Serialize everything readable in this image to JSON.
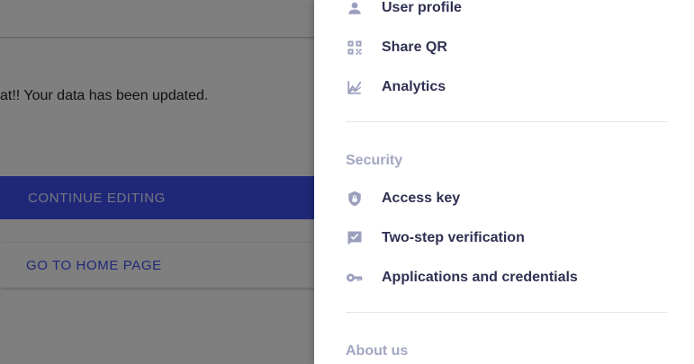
{
  "background": {
    "message": "at!! Your data has been updated.",
    "primary_button": "CONTINUE EDITING",
    "secondary_button": "GO TO HOME PAGE"
  },
  "drawer": {
    "items_top": [
      {
        "label": "User profile",
        "icon": "user-icon"
      },
      {
        "label": "Share QR",
        "icon": "qr-code-icon"
      },
      {
        "label": "Analytics",
        "icon": "analytics-icon"
      }
    ],
    "security": {
      "title": "Security",
      "items": [
        {
          "label": "Access key",
          "icon": "shield-lock-icon"
        },
        {
          "label": "Two-step verification",
          "icon": "verified-message-icon"
        },
        {
          "label": "Applications and credentials",
          "icon": "key-icon"
        }
      ]
    },
    "about": {
      "title": "About us"
    }
  },
  "colors": {
    "primary": "#3f51f0",
    "menu_text": "#2f3152",
    "icon": "#9b9fbd",
    "section_title": "#a3a7c2"
  }
}
